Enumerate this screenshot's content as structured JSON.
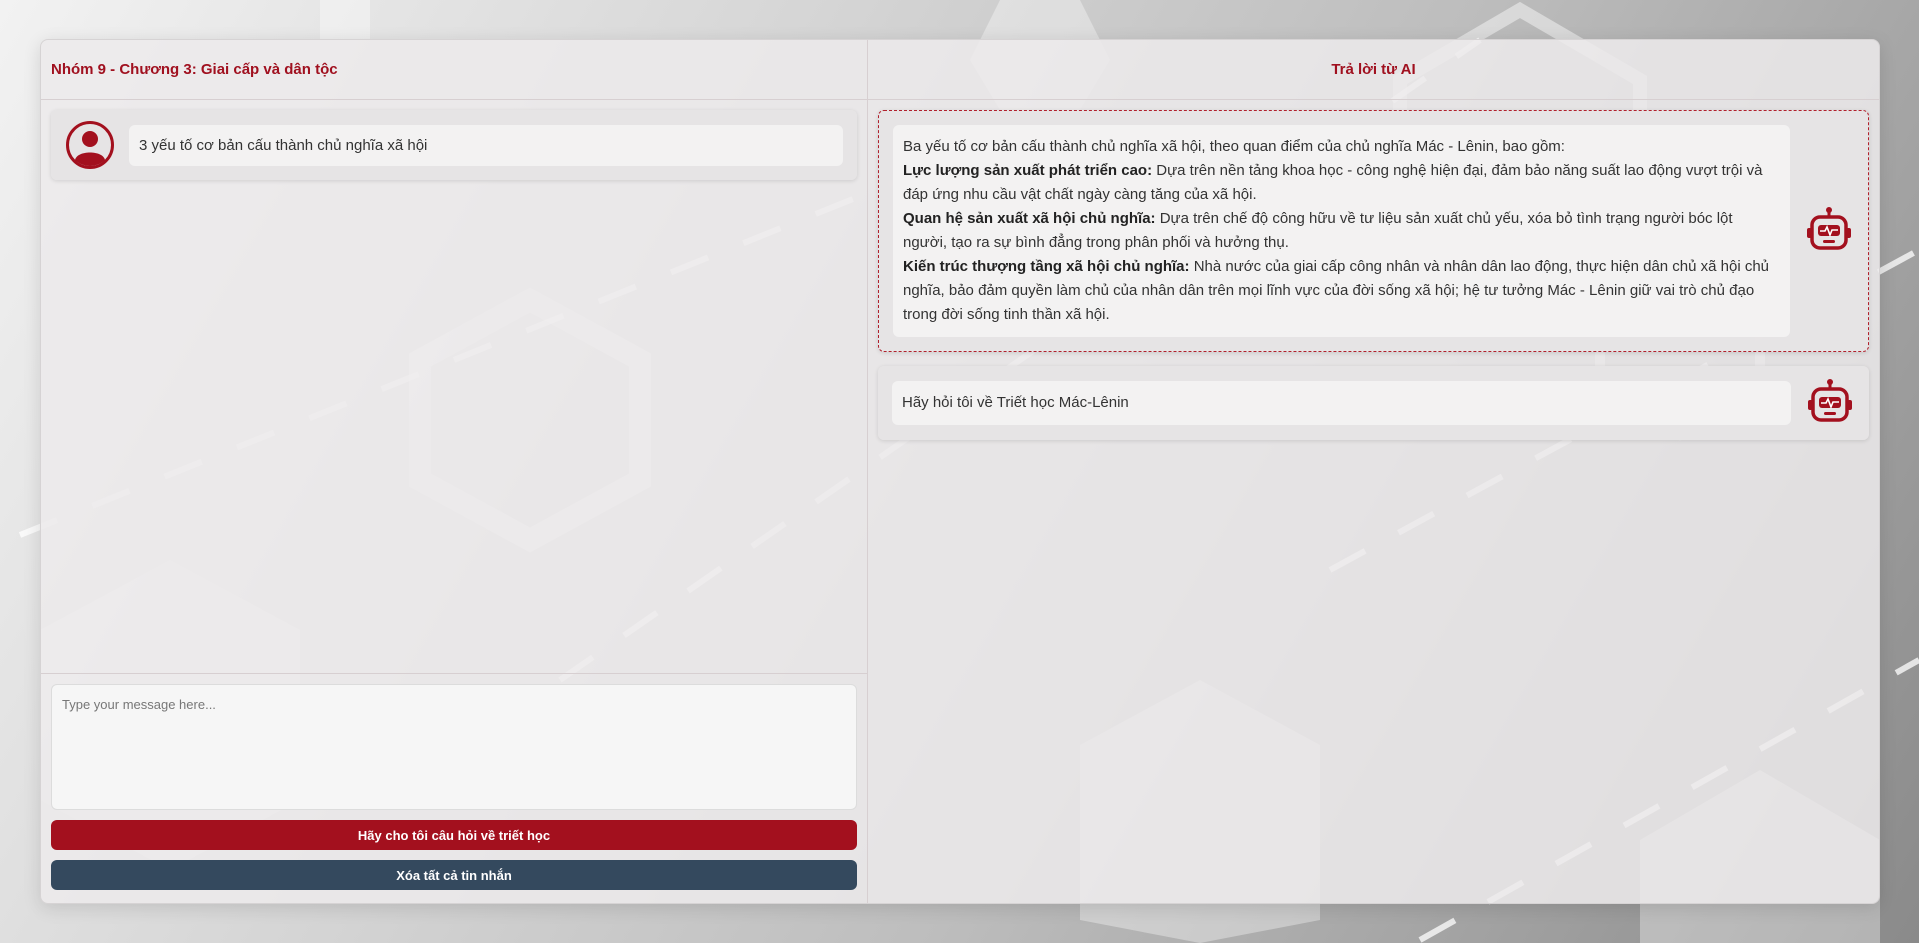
{
  "colors": {
    "accent": "#a3101e",
    "secondary_button": "#34495e",
    "panel": "#ecebeb"
  },
  "left_panel": {
    "title": "Nhóm 9 - Chương 3: Giai cấp và dân tộc",
    "user_message": {
      "avatar_icon": "user-avatar-icon",
      "text": "3 yếu tố cơ bản cấu thành chủ nghĩa xã hội"
    },
    "composer": {
      "placeholder": "Type your message here...",
      "value": "",
      "ask_button_label": "Hãy cho tôi câu hỏi về triết học",
      "clear_button_label": "Xóa tất cả tin nhắn"
    }
  },
  "right_panel": {
    "title": "Trả lời từ AI",
    "ai_answer": {
      "bot_icon": "robot-icon",
      "intro": "Ba yếu tố cơ bản cấu thành chủ nghĩa xã hội, theo quan điểm của chủ nghĩa Mác - Lênin, bao gồm:",
      "items": [
        {
          "heading": "Lực lượng sản xuất phát triển cao:",
          "text": " Dựa trên nền tảng khoa học - công nghệ hiện đại, đảm bảo năng suất lao động vượt trội và đáp ứng nhu cầu vật chất ngày càng tăng của xã hội."
        },
        {
          "heading": "Quan hệ sản xuất xã hội chủ nghĩa:",
          "text": " Dựa trên chế độ công hữu về tư liệu sản xuất chủ yếu, xóa bỏ tình trạng người bóc lột người, tạo ra sự bình đẳng trong phân phối và hưởng thụ."
        },
        {
          "heading": "Kiến trúc thượng tầng xã hội chủ nghĩa:",
          "text": " Nhà nước của giai cấp công nhân và nhân dân lao động, thực hiện dân chủ xã hội chủ nghĩa, bảo đảm quyền làm chủ của nhân dân trên mọi lĩnh vực của đời sống xã hội; hệ tư tưởng Mác - Lênin giữ vai trò chủ đạo trong đời sống tinh thần xã hội."
        }
      ]
    },
    "ai_greeting": {
      "bot_icon": "robot-icon",
      "text": "Hãy hỏi tôi về Triết học Mác-Lênin"
    }
  }
}
